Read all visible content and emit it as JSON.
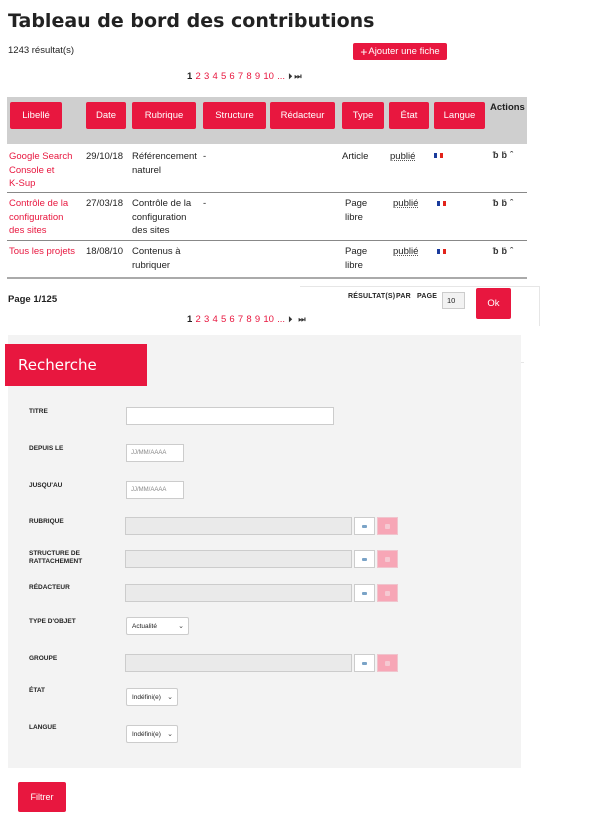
{
  "header": {
    "title": "Tableau de bord des contributions",
    "result_count": "1243 résultat(s)",
    "add_button_plus": "+",
    "add_button_label": "Ajouter une fiche"
  },
  "pagination": {
    "current": "1",
    "pages": [
      "2",
      "3",
      "4",
      "5",
      "6",
      "7",
      "8",
      "9",
      "10"
    ],
    "ellipsis": "...",
    "next_glyph": "⏵",
    "last_glyph": "⏭"
  },
  "table": {
    "columns": [
      "Libellé",
      "Date",
      "Rubrique",
      "Structure",
      "Rédacteur",
      "Type",
      "État",
      "Langue"
    ],
    "actions_header": "Actions",
    "rows": [
      {
        "libelle": [
          "Google Search",
          "Console et",
          "K-Sup"
        ],
        "date": "29/10/18",
        "rubrique": [
          "Référencement",
          "naturel"
        ],
        "structure": "-",
        "type": [
          "Article"
        ],
        "etat": "publié",
        "langue_flag": "fr"
      },
      {
        "libelle": [
          "Contrôle de la",
          "configuration",
          "des sites"
        ],
        "date": "27/03/18",
        "rubrique": [
          "Contrôle de la",
          "configuration",
          "des sites"
        ],
        "structure": "-",
        "type": [
          "Page",
          "libre"
        ],
        "etat": "publié",
        "langue_flag": "fr"
      },
      {
        "libelle": [
          "Tous les projets"
        ],
        "date": "18/08/10",
        "rubrique": [
          "Contenus à",
          "rubriquer"
        ],
        "structure": "",
        "type": [
          "Page",
          "libre"
        ],
        "etat": "publié",
        "langue_flag": "fr"
      }
    ],
    "action_icons": [
      "edit-icon",
      "duplicate-icon",
      "delete-icon"
    ]
  },
  "footer": {
    "page_of": "Page 1/125",
    "rpp_label_1": "RÉSULTAT(S)",
    "rpp_label_2": "PAR",
    "rpp_label_3": "PAGE",
    "rpp_value": "10",
    "ok_label": "Ok"
  },
  "search": {
    "title": "Recherche",
    "labels": {
      "titre": "TITRE",
      "depuis": "DEPUIS LE",
      "jusqua": "JUSQU'AU",
      "rubrique": "RUBRIQUE",
      "structure_1": "STRUCTURE DE",
      "structure_2": "RATTACHEMENT",
      "redacteur": "RÉDACTEUR",
      "type_objet": "TYPE D'OBJET",
      "groupe": "GROUPE",
      "etat": "ÉTAT",
      "langue": "LANGUE"
    },
    "date_placeholder": "JJ/MM/AAAA",
    "type_objet_value": "Actualité",
    "etat_value": "Indéfini(e)",
    "langue_value": "Indéfini(e)",
    "filter_label": "Filtrer"
  },
  "colors": {
    "accent": "#e8173f",
    "header_bg": "#cfcfcf",
    "panel_bg": "#f3f3f3",
    "clear_btn": "#f7a6b6"
  }
}
